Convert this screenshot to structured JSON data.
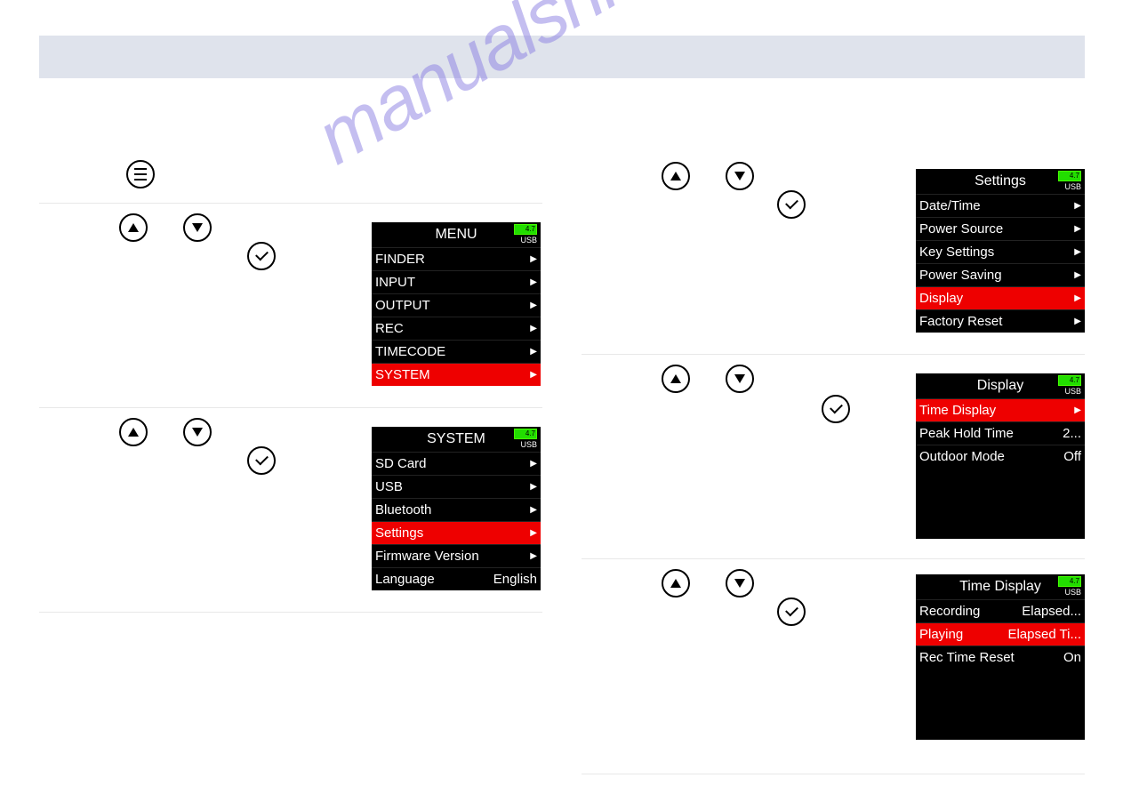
{
  "watermark": "manualshive.com",
  "batteryLabel": "4.7",
  "usbLabel": "USB",
  "screens": {
    "menu": {
      "title": "MENU",
      "items": [
        {
          "label": "FINDER",
          "selected": false,
          "arrow": true
        },
        {
          "label": "INPUT",
          "selected": false,
          "arrow": true
        },
        {
          "label": "OUTPUT",
          "selected": false,
          "arrow": true
        },
        {
          "label": "REC",
          "selected": false,
          "arrow": true
        },
        {
          "label": "TIMECODE",
          "selected": false,
          "arrow": true
        },
        {
          "label": "SYSTEM",
          "selected": true,
          "arrow": true
        }
      ]
    },
    "system": {
      "title": "SYSTEM",
      "items": [
        {
          "label": "SD Card",
          "value": "",
          "selected": false,
          "arrow": true
        },
        {
          "label": "USB",
          "value": "",
          "selected": false,
          "arrow": true
        },
        {
          "label": "Bluetooth",
          "value": "",
          "selected": false,
          "arrow": true
        },
        {
          "label": "Settings",
          "value": "",
          "selected": true,
          "arrow": true
        },
        {
          "label": "Firmware Version",
          "value": "",
          "selected": false,
          "arrow": true
        },
        {
          "label": "Language",
          "value": "English",
          "selected": false,
          "arrow": false
        }
      ]
    },
    "settings": {
      "title": "Settings",
      "items": [
        {
          "label": "Date/Time",
          "selected": false,
          "arrow": true
        },
        {
          "label": "Power Source",
          "selected": false,
          "arrow": true
        },
        {
          "label": "Key Settings",
          "selected": false,
          "arrow": true
        },
        {
          "label": "Power Saving",
          "selected": false,
          "arrow": true
        },
        {
          "label": "Display",
          "selected": true,
          "arrow": true
        },
        {
          "label": "Factory Reset",
          "selected": false,
          "arrow": true
        }
      ]
    },
    "display": {
      "title": "Display",
      "items": [
        {
          "label": "Time Display",
          "value": "",
          "selected": true,
          "arrow": true
        },
        {
          "label": "Peak Hold Time",
          "value": "2...",
          "selected": false,
          "arrow": false
        },
        {
          "label": "Outdoor Mode",
          "value": "Off",
          "selected": false,
          "arrow": false
        }
      ]
    },
    "timedisplay": {
      "title": "Time Display",
      "items": [
        {
          "label": "Recording",
          "value": "Elapsed...",
          "selected": false,
          "arrow": false
        },
        {
          "label": "Playing",
          "value": "Elapsed Ti...",
          "selected": true,
          "arrow": false
        },
        {
          "label": "Rec Time Reset",
          "value": "On",
          "selected": false,
          "arrow": false
        }
      ]
    }
  }
}
